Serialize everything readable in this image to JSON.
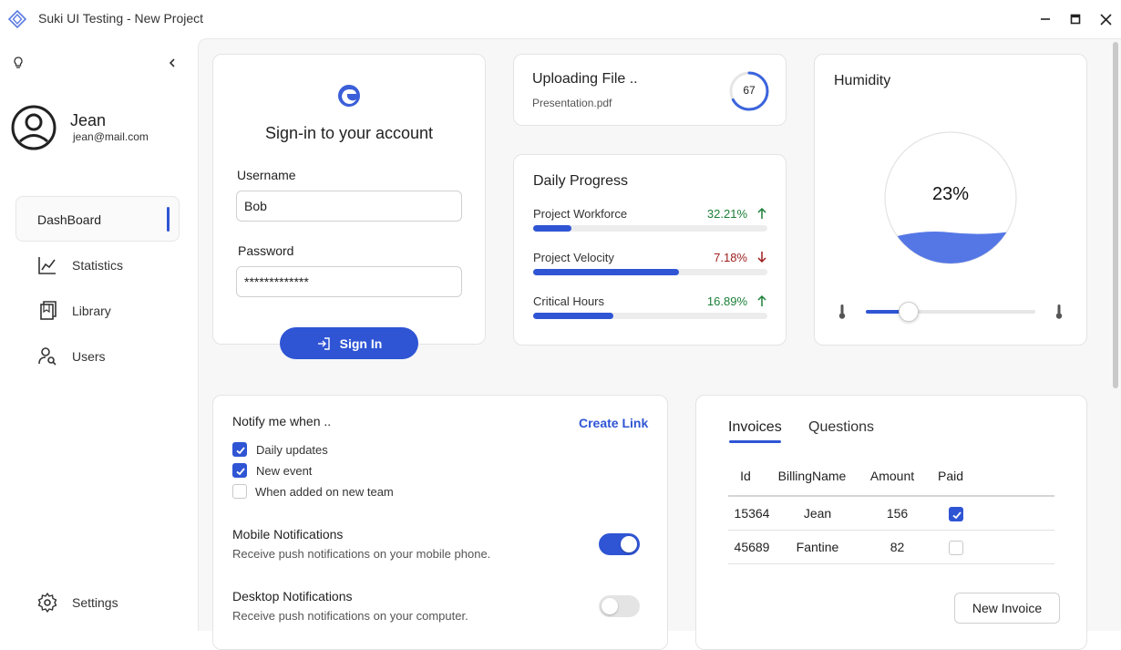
{
  "window": {
    "title": "Suki UI Testing - New Project"
  },
  "user": {
    "name": "Jean",
    "email": "jean@mail.com"
  },
  "nav": {
    "active": "DashBoard",
    "items": [
      {
        "label": "Statistics",
        "icon": "chart-line-icon"
      },
      {
        "label": "Library",
        "icon": "library-icon"
      },
      {
        "label": "Users",
        "icon": "user-search-icon"
      }
    ],
    "settings": "Settings"
  },
  "signin": {
    "title": "Sign-in to your account",
    "username_label": "Username",
    "username_value": "Bob",
    "password_label": "Password",
    "password_value": "*************",
    "button_label": "Sign In"
  },
  "upload": {
    "title": "Uploading File ..",
    "filename": "Presentation.pdf",
    "progress": 67
  },
  "daily_progress": {
    "title": "Daily Progress",
    "rows": [
      {
        "name": "Project Workforce",
        "pct": "32.21%",
        "fraction": 0.1622,
        "trend": "up",
        "color": "#1a7f37"
      },
      {
        "name": "Project Velocity",
        "pct": "7.18%",
        "fraction": 0.6226,
        "trend": "down",
        "color": "#9c1c1c"
      },
      {
        "name": "Critical Hours",
        "pct": "16.89%",
        "fraction": 0.3424,
        "trend": "up",
        "color": "#1a7f37"
      }
    ]
  },
  "humidity": {
    "title": "Humidity",
    "value": "23%",
    "slider_fraction": 0.25
  },
  "notify": {
    "title": "Notify me when ..",
    "link": "Create Link",
    "options": [
      {
        "label": "Daily updates",
        "checked": true
      },
      {
        "label": "New event",
        "checked": true
      },
      {
        "label": "When added on new team",
        "checked": false
      }
    ],
    "mobile": {
      "title": "Mobile Notifications",
      "desc": "Receive push notifications on your mobile phone.",
      "on": true
    },
    "desktop": {
      "title": "Desktop Notifications",
      "desc": "Receive push notifications on your computer.",
      "on": false
    }
  },
  "invoices": {
    "tabs": [
      "Invoices",
      "Questions"
    ],
    "columns": [
      "Id",
      "BillingName",
      "Amount",
      "Paid"
    ],
    "rows": [
      {
        "id": "15364",
        "name": "Jean",
        "amount": "156",
        "paid": true
      },
      {
        "id": "45689",
        "name": "Fantine",
        "amount": "82",
        "paid": false
      }
    ],
    "new_button": "New Invoice"
  },
  "colors": {
    "accent": "#2f55d4",
    "up": "#1a7f37",
    "down": "#9c1c1c"
  }
}
